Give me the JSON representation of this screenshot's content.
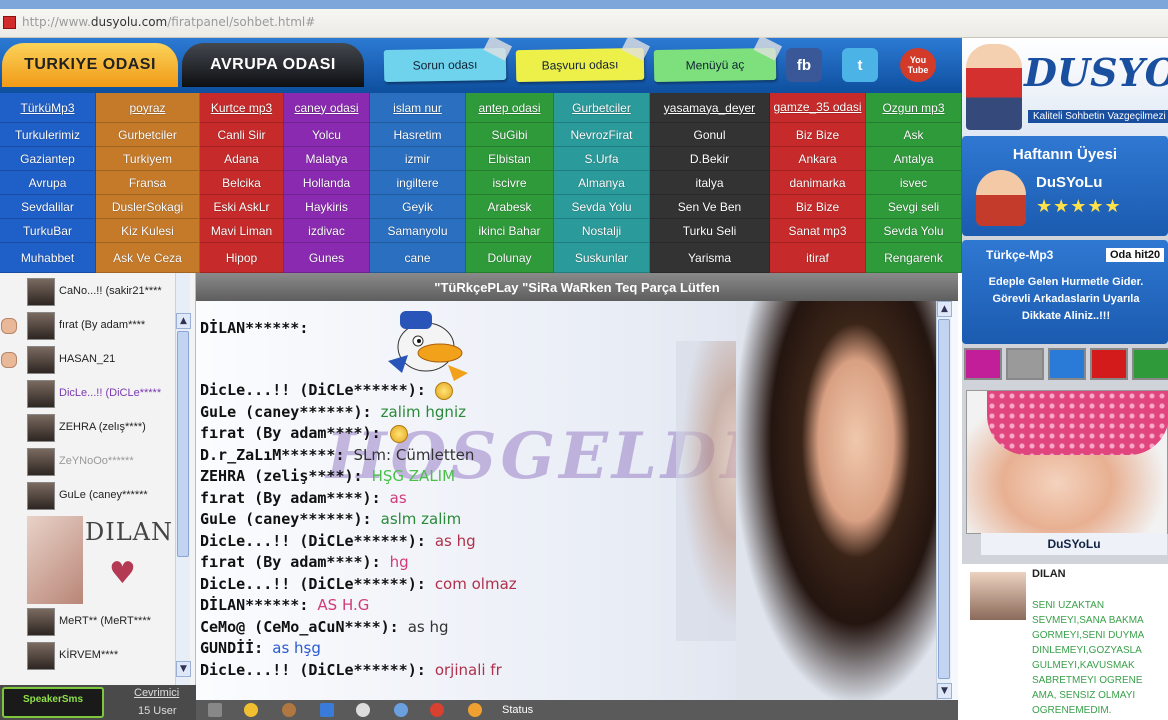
{
  "browser": {
    "url_prefix": "http://www.",
    "url_domain": "dusyolu.com",
    "url_path": "/firatpanel/sohbet.html#"
  },
  "header": {
    "tab1": "TURKIYE ODASI",
    "tab2": "AVRUPA ODASI",
    "btn_sorun": "Sorun odası",
    "btn_basvuru": "Başvuru odası",
    "btn_menu": "Menüyü aç",
    "facebook": "fb",
    "twitter": "t",
    "youtube": "You Tube"
  },
  "logo": {
    "title": "DUSYOLU",
    "subtitle": "Kaliteli Sohbetin Vazgeçilmezi"
  },
  "rooms": [
    [
      {
        "t": "TürküMp3",
        "c": "#1f5fc8",
        "u": true
      },
      {
        "t": "poyraz",
        "c": "#c57a2a",
        "u": true
      },
      {
        "t": "Kurtce mp3",
        "c": "#c62a2a",
        "u": true
      },
      {
        "t": "caney odasi",
        "c": "#8a2ab0",
        "u": true
      },
      {
        "t": "islam nur",
        "c": "#2a6fc0",
        "u": true
      },
      {
        "t": "antep odasi",
        "c": "#2e9a3a",
        "u": true
      },
      {
        "t": "Gurbetciler",
        "c": "#2a9a9a",
        "u": true
      },
      {
        "t": "yasamaya_deyer",
        "c": "#333333",
        "u": true
      },
      {
        "t": "gamze_35 odasi",
        "c": "#c62a2a",
        "u": true
      },
      {
        "t": "Ozgun mp3",
        "c": "#2e9a3a",
        "u": true
      }
    ],
    [
      {
        "t": "Turkulerimiz",
        "c": "#1f5fc8"
      },
      {
        "t": "Gurbetciler",
        "c": "#c57a2a"
      },
      {
        "t": "Canli Siir",
        "c": "#c62a2a"
      },
      {
        "t": "Yolcu",
        "c": "#8a2ab0"
      },
      {
        "t": "Hasretim",
        "c": "#2a6fc0"
      },
      {
        "t": "SuGibi",
        "c": "#2e9a3a"
      },
      {
        "t": "NevrozFirat",
        "c": "#2a9a9a"
      },
      {
        "t": "Gonul",
        "c": "#333333"
      },
      {
        "t": "Biz Bize",
        "c": "#c62a2a"
      },
      {
        "t": "Ask",
        "c": "#2e9a3a"
      }
    ],
    [
      {
        "t": "Gaziantep",
        "c": "#1f5fc8"
      },
      {
        "t": "Turkiyem",
        "c": "#c57a2a"
      },
      {
        "t": "Adana",
        "c": "#c62a2a"
      },
      {
        "t": "Malatya",
        "c": "#8a2ab0"
      },
      {
        "t": "izmir",
        "c": "#2a6fc0"
      },
      {
        "t": "Elbistan",
        "c": "#2e9a3a"
      },
      {
        "t": "S.Urfa",
        "c": "#2a9a9a"
      },
      {
        "t": "D.Bekir",
        "c": "#333333"
      },
      {
        "t": "Ankara",
        "c": "#c62a2a"
      },
      {
        "t": "Antalya",
        "c": "#2e9a3a"
      }
    ],
    [
      {
        "t": "Avrupa",
        "c": "#1f5fc8"
      },
      {
        "t": "Fransa",
        "c": "#c57a2a"
      },
      {
        "t": "Belcika",
        "c": "#c62a2a"
      },
      {
        "t": "Hollanda",
        "c": "#8a2ab0"
      },
      {
        "t": "ingiltere",
        "c": "#2a6fc0"
      },
      {
        "t": "iscivre",
        "c": "#2e9a3a"
      },
      {
        "t": "Almanya",
        "c": "#2a9a9a"
      },
      {
        "t": "italya",
        "c": "#333333"
      },
      {
        "t": "danimarka",
        "c": "#c62a2a"
      },
      {
        "t": "isvec",
        "c": "#2e9a3a"
      }
    ],
    [
      {
        "t": "Sevdalilar",
        "c": "#1f5fc8"
      },
      {
        "t": "DuslerSokagi",
        "c": "#c57a2a"
      },
      {
        "t": "Eski AskLr",
        "c": "#c62a2a"
      },
      {
        "t": "Haykiris",
        "c": "#8a2ab0"
      },
      {
        "t": "Geyik",
        "c": "#2a6fc0"
      },
      {
        "t": "Arabesk",
        "c": "#2e9a3a"
      },
      {
        "t": "Sevda Yolu",
        "c": "#2a9a9a"
      },
      {
        "t": "Sen Ve Ben",
        "c": "#333333"
      },
      {
        "t": "Biz Bize",
        "c": "#c62a2a"
      },
      {
        "t": "Sevgi seli",
        "c": "#2e9a3a"
      }
    ],
    [
      {
        "t": "TurkuBar",
        "c": "#1f5fc8"
      },
      {
        "t": "Kiz Kulesi",
        "c": "#c57a2a"
      },
      {
        "t": "Mavi Liman",
        "c": "#c62a2a"
      },
      {
        "t": "izdivac",
        "c": "#8a2ab0"
      },
      {
        "t": "Samanyolu",
        "c": "#2a6fc0"
      },
      {
        "t": "ikinci Bahar",
        "c": "#2e9a3a"
      },
      {
        "t": "Nostalji",
        "c": "#2a9a9a"
      },
      {
        "t": "Turku Seli",
        "c": "#333333"
      },
      {
        "t": "Sanat mp3",
        "c": "#c62a2a"
      },
      {
        "t": "Sevda Yolu",
        "c": "#2e9a3a"
      }
    ],
    [
      {
        "t": "Muhabbet",
        "c": "#1f5fc8"
      },
      {
        "t": "Ask Ve Ceza",
        "c": "#c57a2a"
      },
      {
        "t": "Hipop",
        "c": "#c62a2a"
      },
      {
        "t": "Gunes",
        "c": "#8a2ab0"
      },
      {
        "t": "cane",
        "c": "#2a6fc0"
      },
      {
        "t": "Dolunay",
        "c": "#2e9a3a"
      },
      {
        "t": "Suskunlar",
        "c": "#2a9a9a"
      },
      {
        "t": "Yarisma",
        "c": "#333333"
      },
      {
        "t": "itiraf",
        "c": "#c62a2a"
      },
      {
        "t": "Rengarenk",
        "c": "#2e9a3a"
      }
    ]
  ],
  "users": [
    {
      "name": "CaNo...!! (sakir21****",
      "hand": false,
      "color": "#222"
    },
    {
      "name": "fırat (By adam****",
      "hand": true,
      "color": "#222"
    },
    {
      "name": "HASAN_21",
      "hand": true,
      "color": "#222"
    },
    {
      "name": "DicLe...!! (DiCLe*****",
      "hand": false,
      "color": "#7a3ab0"
    },
    {
      "name": "ZEHRA (zelış****)",
      "hand": false,
      "color": "#222"
    },
    {
      "name": "ZeYNoOo******",
      "hand": false,
      "color": "#999"
    },
    {
      "name": "GuLe (caney******",
      "hand": false,
      "color": "#222"
    }
  ],
  "users_after": [
    {
      "name": "MeRT** (MeRT****",
      "color": "#222"
    },
    {
      "name": "KİRVEM****",
      "color": "#222"
    }
  ],
  "dilan_card": "DILAN",
  "userlist_footer": {
    "logo": "SpeakerSms",
    "online_label": "Cevrimici",
    "count": "15 User"
  },
  "chat": {
    "title": "\"TüRkçePLay \"SiRa WaRken Teq Parça Lütfen",
    "welcome": "HOSGELDINIZ",
    "first_speaker": "DİLAN******:",
    "messages": [
      {
        "who": "DicLe...!! (DiCLe******):",
        "text": "",
        "color": "#111",
        "emo": true
      },
      {
        "who": "GuLe (caney******):",
        "text": "zalim hgniz",
        "color": "#2a8a3a",
        "emo": false
      },
      {
        "who": "fırat (By adam****):",
        "text": "",
        "color": "#111",
        "emo": true
      },
      {
        "who": "D.r_ZaLıM******:",
        "text": "SLm: Cümletten",
        "color": "#333",
        "emo": false
      },
      {
        "who": "ZEHRA (zeliş****):",
        "text": "HŞG ZALIM",
        "color": "#4ac04a",
        "emo": false
      },
      {
        "who": "fırat (By adam****):",
        "text": "as",
        "color": "#d23a7a",
        "emo": false
      },
      {
        "who": "GuLe (caney******):",
        "text": "aslm zalim",
        "color": "#2a8a3a",
        "emo": false
      },
      {
        "who": "DicLe...!! (DiCLe******):",
        "text": "as hg",
        "color": "#b0304a",
        "emo": false
      },
      {
        "who": "fırat (By adam****):",
        "text": "hg",
        "color": "#d23a7a",
        "emo": false
      },
      {
        "who": "DicLe...!! (DiCLe******):",
        "text": "com olmaz",
        "color": "#b0304a",
        "emo": false
      },
      {
        "who": "DİLAN******:",
        "text": "AS H.G",
        "color": "#d23a7a",
        "emo": false
      },
      {
        "who": "CeMo@ (CeMo_aCuN****):",
        "text": "as hg",
        "color": "#333",
        "emo": false
      },
      {
        "who": "GUNDİİ:",
        "text": "as hşg",
        "color": "#2a5ad0",
        "emo": false
      },
      {
        "who": "DicLe...!! (DiCLe******):",
        "text": "orjinali fr",
        "color": "#b0304a",
        "emo": false
      }
    ]
  },
  "chat_footer": {
    "status": "Status"
  },
  "right": {
    "week_title": "Haftanın Üyesi",
    "week_name": "DuSYoLu",
    "stars": "★★★★★",
    "mp3_label": "Türkçe-Mp3",
    "mp3_badge": "Oda hit20",
    "notice": [
      "Edeple Gelen Hurmetle Gider.",
      "Görevli Arkadaslarin Uyarıla",
      "Dikkate Aliniz..!!!"
    ],
    "swatches": [
      "#c21e9a",
      "#9a9a9a",
      "#2a7ad8",
      "#d41b1b",
      "#2e9a3a"
    ],
    "photo_name": "DuSYoLu",
    "wall_name": "DILAN",
    "wall_lines": [
      "SENI UZAKTAN",
      "SEVMEYI,SANA BAKMA",
      "GORMEYI,SENI DUYMA",
      "DINLEMEYI,GOZYASLA",
      "GULMEYI,KAVUSMAK",
      "SABRETMEYI OGRENE",
      "AMA, SENSIZ OLMAYI",
      "OGRENEMEDIM."
    ]
  }
}
